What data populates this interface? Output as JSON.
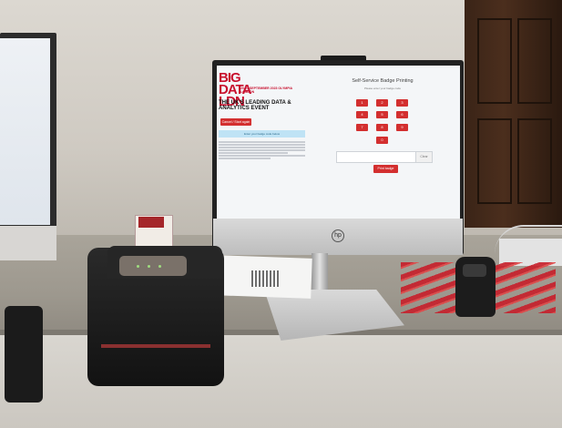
{
  "screen": {
    "event_logo": "BIG DATA LDN",
    "event_dates": "20-21 SEPTEMBER 2023 OLYMPIA LONDON",
    "tagline": "THE UK'S LEADING DATA & ANALYTICS EVENT",
    "cancel_button": "Cancel / Start again",
    "info_bar": "Enter your badge code below",
    "page_title": "Self-Service Badge Printing",
    "page_subtitle": "Please enter your badge code",
    "keypad": [
      "1",
      "2",
      "3",
      "4",
      "5",
      "6",
      "7",
      "8",
      "9",
      "0"
    ],
    "clear_button": "Clear",
    "print_button": "Print badge"
  },
  "monitor_brand": "hp",
  "colors": {
    "accent": "#d32f2f",
    "info": "#bfe3f5",
    "brand": "#c8102e"
  }
}
